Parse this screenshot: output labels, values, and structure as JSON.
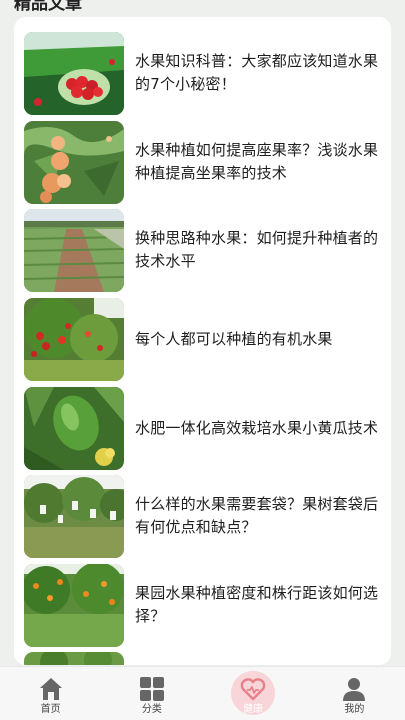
{
  "section": {
    "title": "精品文章"
  },
  "articles": [
    {
      "title": "水果知识科普：大家都应该知道水果的7个小秘密！"
    },
    {
      "title": "水果种植如何提高座果率？浅谈水果种植提高坐果率的技术"
    },
    {
      "title": "换种思路种水果：如何提升种植者的技术水平"
    },
    {
      "title": "每个人都可以种植的有机水果"
    },
    {
      "title": "水肥一体化高效栽培水果小黄瓜技术"
    },
    {
      "title": "什么样的水果需要套袋？果树套袋后有何优点和缺点？"
    },
    {
      "title": "果园水果种植密度和株行距该如何选择？"
    }
  ],
  "tabbar": {
    "items": [
      {
        "label": "首页",
        "icon": "home-icon"
      },
      {
        "label": "分类",
        "icon": "grid-icon"
      },
      {
        "label": "健康",
        "icon": "heart-icon",
        "active": true
      },
      {
        "label": "我的",
        "icon": "user-icon"
      }
    ]
  },
  "colors": {
    "accent": "#f7d5d8",
    "heart": "#e8808a",
    "icon": "#666666"
  }
}
